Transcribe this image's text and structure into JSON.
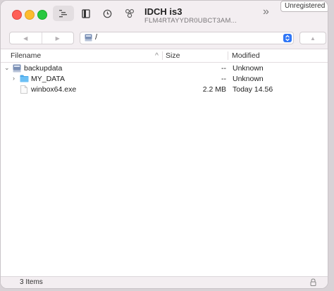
{
  "window": {
    "title": "IDCH is3",
    "subtitle": "FLM4RTAYYDR0UBCT3AM...",
    "unregistered_label": "Unregistered"
  },
  "toolbar": {
    "buttons": [
      {
        "name": "outline-view-icon"
      },
      {
        "name": "bookmark-icon"
      },
      {
        "name": "history-icon"
      },
      {
        "name": "transfers-icon"
      }
    ],
    "overflow_glyph": "»"
  },
  "pathbar": {
    "back_glyph": "◀",
    "forward_glyph": "▶",
    "current_path": "/",
    "up_glyph": "▲"
  },
  "columns": {
    "filename": "Filename",
    "size": "Size",
    "modified": "Modified",
    "sort_glyph": "^"
  },
  "files": [
    {
      "name": "backupdata",
      "size": "--",
      "modified": "Unknown",
      "kind": "drive",
      "disclosure": "⌄",
      "indent": 0
    },
    {
      "name": "MY_DATA",
      "size": "--",
      "modified": "Unknown",
      "kind": "folder",
      "disclosure": "›",
      "indent": 1
    },
    {
      "name": "winbox64.exe",
      "size": "2.2 MB",
      "modified": "Today 14.56",
      "kind": "file",
      "disclosure": "",
      "indent": 1
    }
  ],
  "status": {
    "item_count": "3 Items"
  },
  "colors": {
    "accent": "#2f76f6",
    "folder": "#4aa8ea",
    "chrome": "#f3eef1"
  }
}
